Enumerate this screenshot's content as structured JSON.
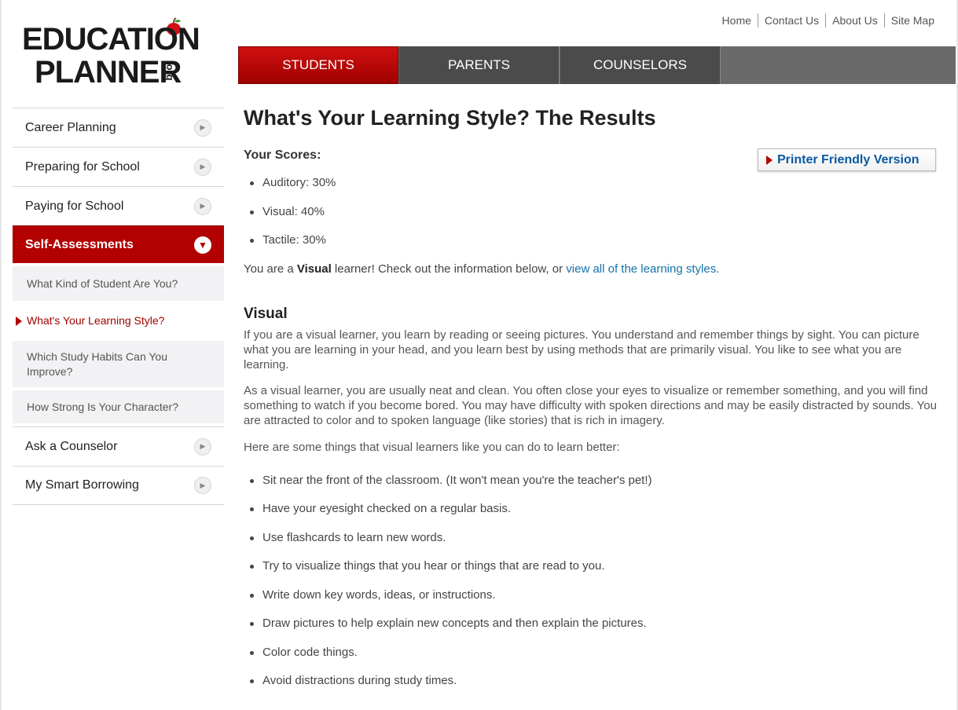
{
  "logo": {
    "line1": "EDUCATION",
    "line2": "PLANNER",
    "suffix": ".org",
    "icon": "apple-icon"
  },
  "utility_nav": [
    "Home",
    "Contact Us",
    "About Us",
    "Site Map"
  ],
  "main_tabs": [
    {
      "label": "STUDENTS",
      "active": true
    },
    {
      "label": "PARENTS",
      "active": false
    },
    {
      "label": "COUNSELORS",
      "active": false
    }
  ],
  "sidebar": {
    "items": [
      {
        "label": "Career Planning"
      },
      {
        "label": "Preparing for School"
      },
      {
        "label": "Paying for School"
      },
      {
        "label": "Self-Assessments",
        "active": true
      },
      {
        "label": "Ask a Counselor"
      },
      {
        "label": "My Smart Borrowing"
      }
    ],
    "subitems": [
      {
        "label": "What Kind of Student Are You?"
      },
      {
        "label": "What's Your Learning Style?",
        "current": true
      },
      {
        "label": "Which Study Habits Can You Improve?"
      },
      {
        "label": "How Strong Is Your Character?"
      }
    ]
  },
  "content": {
    "title": "What's Your Learning Style? The Results",
    "scores_label": "Your Scores:",
    "printer_label": "Printer Friendly Version",
    "scores": [
      "Auditory: 30%",
      "Visual: 40%",
      "Tactile: 30%"
    ],
    "result_prefix": "You are a ",
    "result_style": "Visual",
    "result_middle": " learner! Check out the information below, or ",
    "result_link": "view all of the learning styles",
    "result_suffix": ".",
    "section_title": "Visual",
    "para1": "If you are a visual learner, you learn by reading or seeing pictures. You understand and remember things by sight. You can picture what you are learning in your head, and you learn best by using methods that are primarily visual. You like to see what you are learning.",
    "para2": "As a visual learner, you are usually neat and clean. You often close your eyes to visualize or remember something, and you will find something to watch if you become bored. You may have difficulty with spoken directions and may be easily distracted by sounds. You are attracted to color and to spoken language (like stories) that is rich in imagery.",
    "tips_intro": "Here are some things that visual learners like you can do to learn better:",
    "tips": [
      "Sit near the front of the classroom. (It won't mean you're the teacher's pet!)",
      "Have your eyesight checked on a regular basis.",
      "Use flashcards to learn new words.",
      "Try to visualize things that you hear or things that are read to you.",
      "Write down key words, ideas, or instructions.",
      "Draw pictures to help explain new concepts and then explain the pictures.",
      "Color code things.",
      "Avoid distractions during study times."
    ]
  }
}
